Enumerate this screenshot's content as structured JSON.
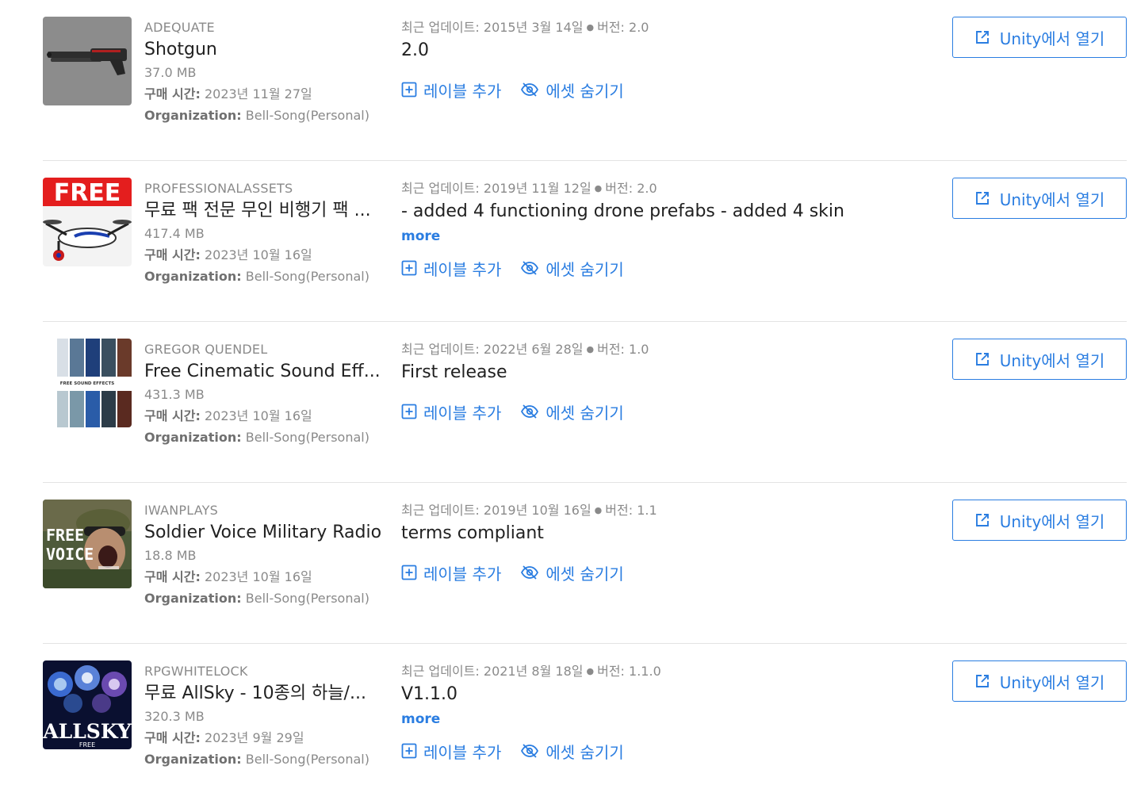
{
  "labels": {
    "updated_prefix": "최근 업데이트:",
    "version_prefix": "버전:",
    "purchased_prefix": "구매 시간",
    "organization_prefix": "Organization",
    "add_label": "레이블 추가",
    "hide_asset": "에셋 숨기기",
    "open_in_unity": "Unity에서 열기",
    "more": "more"
  },
  "colors": {
    "accent": "#2a7de1",
    "muted_text": "#8a8a8a",
    "divider": "#e3e3e3"
  },
  "assets": [
    {
      "publisher": "ADEQUATE",
      "title": "Shotgun",
      "size": "37.0 MB",
      "purchased": "2023년 11월 27일",
      "organization": "Bell-Song(Personal)",
      "updated": "2015년 3월 14일",
      "version": "2.0",
      "notes": "2.0",
      "show_more": false,
      "thumb_icon": "shotgun-thumbnail"
    },
    {
      "publisher": "PROFESSIONALASSETS",
      "title": "무료 팩 전문 무인 비행기 팩 ...",
      "size": "417.4 MB",
      "purchased": "2023년 10월 16일",
      "organization": "Bell-Song(Personal)",
      "updated": "2019년 11월 12일",
      "version": "2.0",
      "notes": "- added 4 functioning drone prefabs - added 4 skin",
      "show_more": true,
      "thumb_text": "FREE",
      "thumb_icon": "drone-thumbnail"
    },
    {
      "publisher": "GREGOR QUENDEL",
      "title": "Free Cinematic Sound Eff...",
      "size": "431.3 MB",
      "purchased": "2023년 10월 16일",
      "organization": "Bell-Song(Personal)",
      "updated": "2022년 6월 28일",
      "version": "1.0",
      "notes": "First release",
      "show_more": false,
      "thumb_text": "FREE SOUND EFFECTS",
      "thumb_icon": "sound-effects-thumbnail"
    },
    {
      "publisher": "IWANPLAYS",
      "title": "Soldier Voice Military Radio",
      "size": "18.8 MB",
      "purchased": "2023년 10월 16일",
      "organization": "Bell-Song(Personal)",
      "updated": "2019년 10월 16일",
      "version": "1.1",
      "notes": "terms compliant",
      "show_more": false,
      "thumb_text_1": "FREE",
      "thumb_text_2": "VOICE",
      "thumb_icon": "soldier-voice-thumbnail"
    },
    {
      "publisher": "RPGWHITELOCK",
      "title": "무료 AllSky - 10종의 하늘/...",
      "size": "320.3 MB",
      "purchased": "2023년 9월 29일",
      "organization": "Bell-Song(Personal)",
      "updated": "2021년 8월 18일",
      "version": "1.1.0",
      "notes": "V1.1.0",
      "show_more": true,
      "thumb_text_1": "ALLSKY",
      "thumb_text_2": "FREE",
      "thumb_icon": "allsky-thumbnail"
    }
  ]
}
